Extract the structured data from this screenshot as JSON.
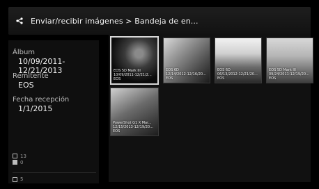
{
  "header": {
    "title": "Enviar/recibir imágenes > Bandeja de en...",
    "back_icon": "share-back-icon"
  },
  "info": {
    "album_label": "Álbum",
    "album_value": "10/09/2011-12/21/2013",
    "remitente_label": "Remitente",
    "remitente_value": "EOS",
    "fecha_label": "Fecha recepción",
    "fecha_value": "1/1/2015"
  },
  "counts": {
    "photos": "13",
    "videos": "0",
    "books": "5"
  },
  "tiles": [
    {
      "line1": "EOS 5D Mark III",
      "line2": "10/09/2011-12/21/2...",
      "line3": "EOS"
    },
    {
      "line1": "EOS 6D",
      "line2": "12/14/2012-12/16/20...",
      "line3": "EOS"
    },
    {
      "line1": "EOS 6D",
      "line2": "06/13/2012-12/21/20...",
      "line3": "EOS"
    },
    {
      "line1": "EOS 5D Mark III",
      "line2": "09/24/2011-12/19/20...",
      "line3": "EOS"
    },
    {
      "line1": "PowerShot G1 X Mar...",
      "line2": "12/15/2013-12/19/20...",
      "line3": "EOS"
    }
  ]
}
